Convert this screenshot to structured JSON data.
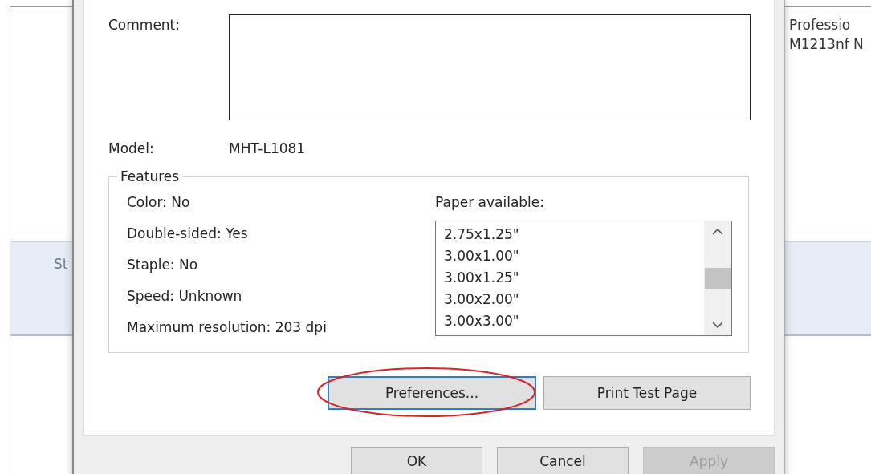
{
  "background_window": {
    "band_text": "St",
    "side_text": [
      "Professio",
      "M1213nf N"
    ]
  },
  "dialog": {
    "comment_label": "Comment:",
    "model_label": "Model:",
    "model_value": "MHT-L1081",
    "features": {
      "title": "Features",
      "items": [
        "Color: No",
        "Double-sided: Yes",
        "Staple: No",
        "Speed: Unknown",
        "Maximum resolution: 203 dpi"
      ],
      "paper_label": "Paper available:",
      "paper_list": [
        "2.75x1.25\"",
        "3.00x1.00\"",
        "3.00x1.25\"",
        "3.00x2.00\"",
        "3.00x3.00\""
      ]
    },
    "panel_buttons": [
      {
        "label": "Preferences...",
        "focused": true,
        "circled": true
      },
      {
        "label": "Print Test Page",
        "focused": false,
        "circled": false
      }
    ],
    "buttons": [
      {
        "label": "OK",
        "disabled": false
      },
      {
        "label": "Cancel",
        "disabled": false
      },
      {
        "label": "Apply",
        "disabled": true
      }
    ]
  }
}
